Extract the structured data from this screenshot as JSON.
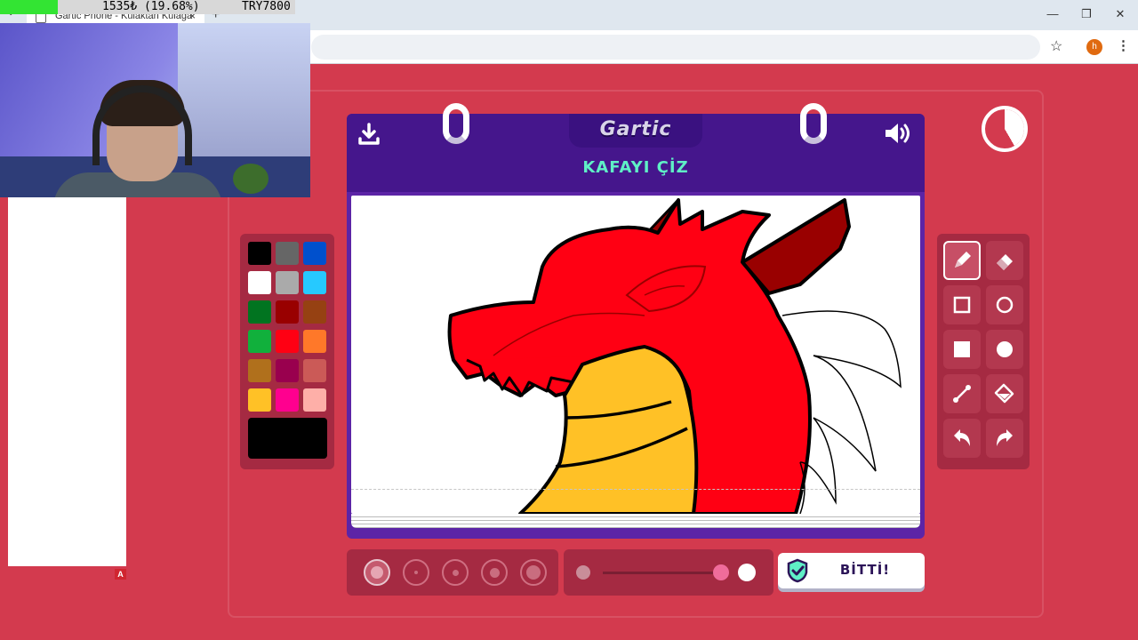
{
  "browser": {
    "tab_title": "Gartic Phone - Kulaktan Kulağa",
    "close_glyph": "×",
    "new_tab_glyph": "+",
    "dropdown_glyph": "⌄",
    "minimize_glyph": "—",
    "restore_glyph": "❐",
    "window_close_glyph": "✕",
    "star_glyph": "☆",
    "profile_initial": "h",
    "menu_glyph": "⋮"
  },
  "stream_overlay": {
    "stat_left": "1535₺ (19.68%)",
    "stat_right": "TRY7800",
    "badge": "A"
  },
  "game": {
    "logo": "Gartic",
    "prompt": "KAFAYI ÇİZ",
    "done_label": "BİTTİ!",
    "accent_color": "#5ff0c6",
    "palette": [
      "#000000",
      "#666666",
      "#0050cd",
      "#ffffff",
      "#aaaaaa",
      "#26c9ff",
      "#017420",
      "#990000",
      "#964112",
      "#11b03c",
      "#ff0013",
      "#ff7829",
      "#b0701c",
      "#99004e",
      "#cb5a57",
      "#ffc126",
      "#ff008f",
      "#feafa8"
    ],
    "selected_color": "#000000",
    "selected_tool": "pencil-icon",
    "tools": [
      "pencil-icon",
      "eraser-icon",
      "rectangle-icon",
      "ellipse-icon",
      "filled-rectangle-icon",
      "filled-ellipse-icon",
      "line-icon",
      "fill-bucket-icon",
      "undo-icon",
      "redo-icon"
    ],
    "brush_sizes": 5,
    "selected_brush_size": 1,
    "opacity": 0.9
  }
}
